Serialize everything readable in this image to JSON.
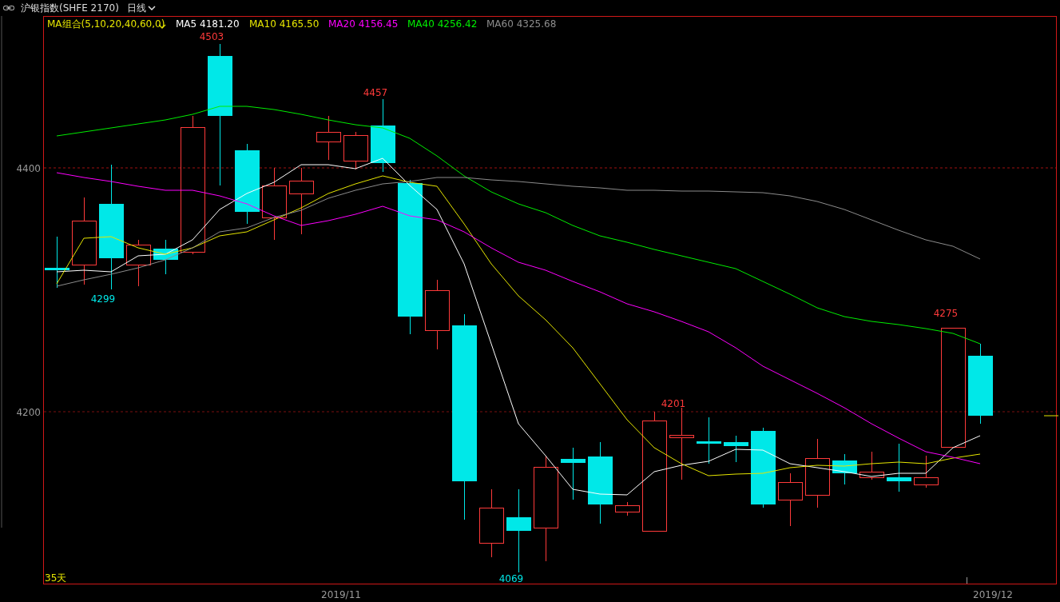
{
  "header": {
    "title": "沪银指数(SHFE 2170)",
    "period": "日线"
  },
  "legend": {
    "combo": "MA组合(5,10,20,40,60,0)",
    "items": [
      {
        "label": "MA5 4181.20",
        "color": "#ffffff"
      },
      {
        "label": "MA10 4165.50",
        "color": "#e6e600"
      },
      {
        "label": "MA20 4156.45",
        "color": "#ff00ff"
      },
      {
        "label": "MA40 4256.42",
        "color": "#00ee00"
      },
      {
        "label": "MA60 4325.68",
        "color": "#8c8c8c"
      }
    ]
  },
  "chart": {
    "price_labels": [
      "4400",
      "4200"
    ],
    "annotations": [
      {
        "text": "4503",
        "kind": "high"
      },
      {
        "text": "4457",
        "kind": "high"
      },
      {
        "text": "4299",
        "kind": "low"
      },
      {
        "text": "4201",
        "kind": "high"
      },
      {
        "text": "4275",
        "kind": "high"
      },
      {
        "text": "4069",
        "kind": "low"
      }
    ],
    "days": "35天",
    "dates": [
      "2019/11",
      "2019/12"
    ]
  }
}
